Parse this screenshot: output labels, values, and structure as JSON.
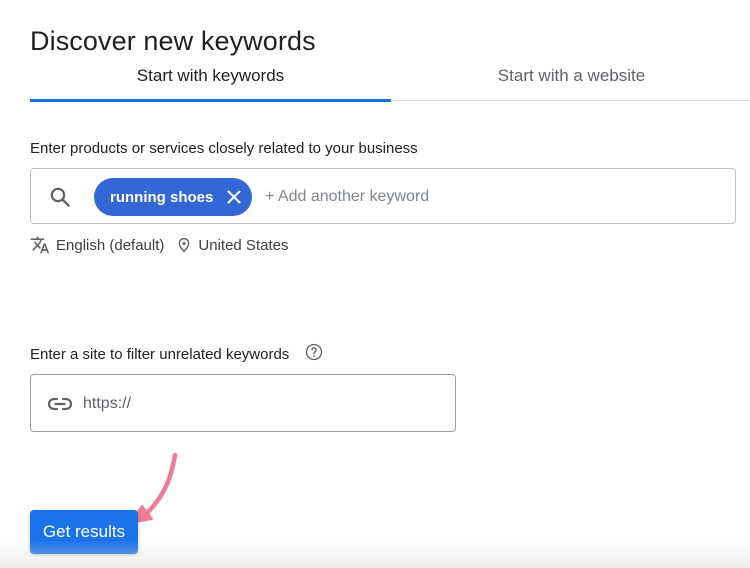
{
  "page": {
    "title": "Discover new keywords"
  },
  "tabs": [
    {
      "label": "Start with keywords",
      "active": true
    },
    {
      "label": "Start with a website",
      "active": false
    }
  ],
  "keywords_section": {
    "label": "Enter products or services closely related to your business",
    "chips": [
      "running shoes"
    ],
    "placeholder": "+ Add another keyword",
    "value": ""
  },
  "locale": {
    "language": "English (default)",
    "location": "United States"
  },
  "site_filter": {
    "label": "Enter a site to filter unrelated keywords",
    "placeholder": "https://",
    "value": ""
  },
  "actions": {
    "get_results": "Get results"
  },
  "colors": {
    "accent": "#1a73e8",
    "chip": "#3367d6",
    "annotation_arrow": "#ee7d93"
  },
  "icons": [
    "search-icon",
    "close-icon",
    "translate-icon",
    "location-pin-icon",
    "help-icon",
    "link-icon",
    "annotation-arrow"
  ]
}
